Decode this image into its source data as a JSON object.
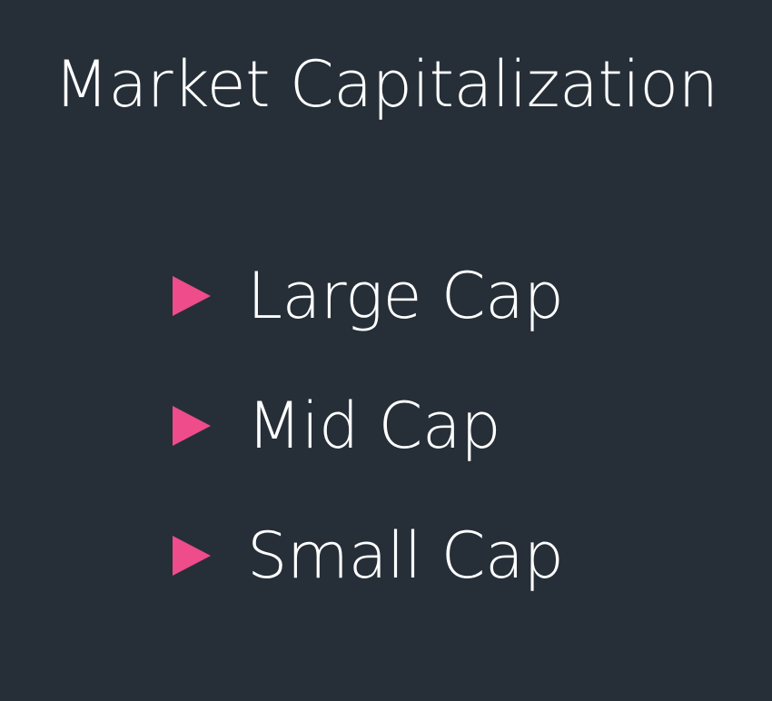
{
  "slide": {
    "title": "Market Capitalization",
    "background_color": "#262f38",
    "accent_color": "#ee4c8a",
    "bullet_icon": "triangle-right-icon",
    "items": [
      {
        "label": "Large Cap"
      },
      {
        "label": "Mid Cap"
      },
      {
        "label": "Small Cap"
      }
    ]
  }
}
